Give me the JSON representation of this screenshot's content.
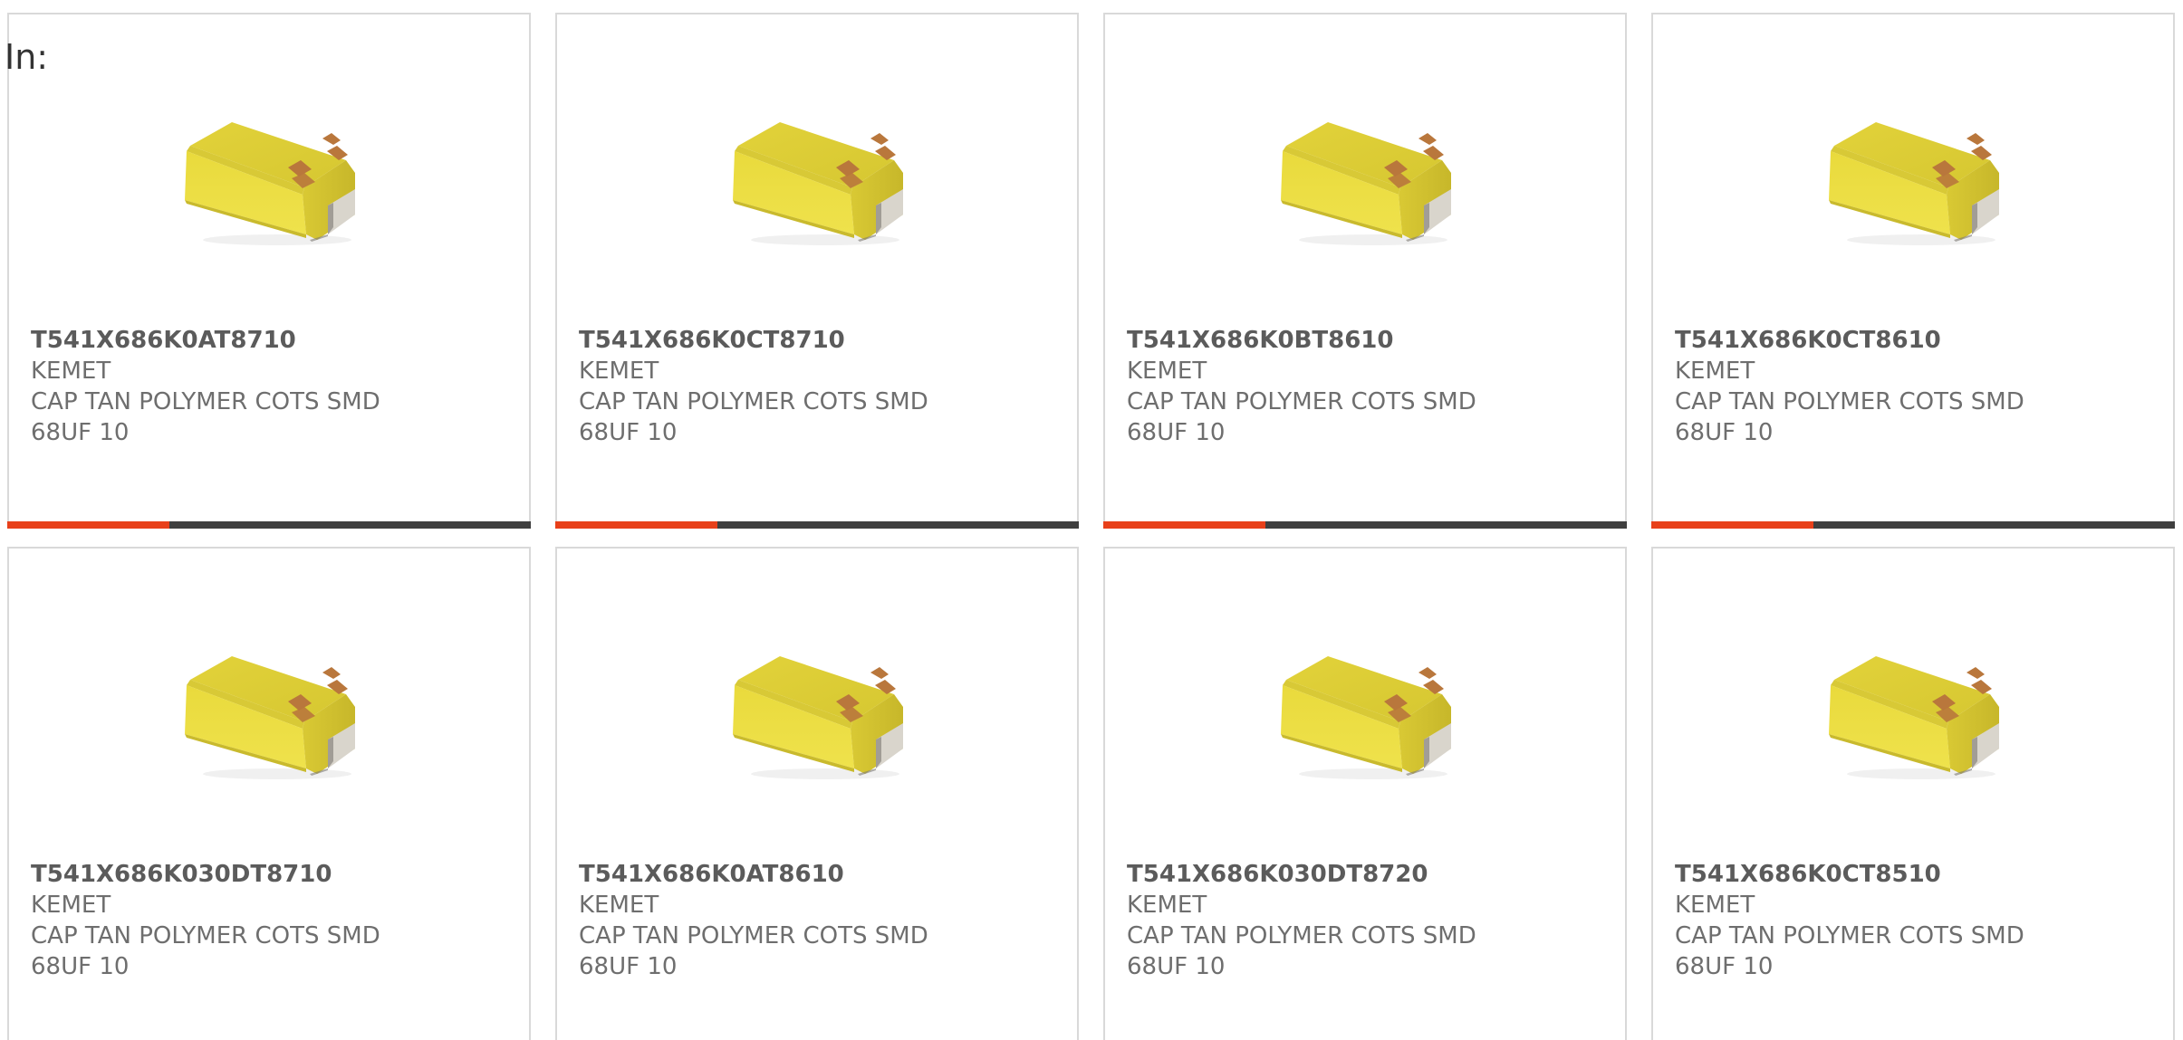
{
  "filter": {
    "label": "In:"
  },
  "colors": {
    "bar_track": "#3f3f3f",
    "bar_fill": "#e8401a",
    "part_number_text": "#5b5b5b",
    "secondary_text": "#6e6e6e",
    "card_border": "#d9d9d9",
    "capacitor_body": "#e9da3c",
    "capacitor_terminal": "#b9773c"
  },
  "products": [
    {
      "part_number": "T541X686K0AT8710",
      "manufacturer": "KEMET",
      "description_line1": "CAP TAN POLYMER COTS SMD",
      "description_line2": "68UF 10",
      "image_icon": "tantalum-capacitor-icon",
      "bar_fill_fraction": 0.31
    },
    {
      "part_number": "T541X686K0CT8710",
      "manufacturer": "KEMET",
      "description_line1": "CAP TAN POLYMER COTS SMD",
      "description_line2": "68UF 10",
      "image_icon": "tantalum-capacitor-icon",
      "bar_fill_fraction": 0.31
    },
    {
      "part_number": "T541X686K0BT8610",
      "manufacturer": "KEMET",
      "description_line1": "CAP TAN POLYMER COTS SMD",
      "description_line2": "68UF 10",
      "image_icon": "tantalum-capacitor-icon",
      "bar_fill_fraction": 0.31
    },
    {
      "part_number": "T541X686K0CT8610",
      "manufacturer": "KEMET",
      "description_line1": "CAP TAN POLYMER COTS SMD",
      "description_line2": "68UF 10",
      "image_icon": "tantalum-capacitor-icon",
      "bar_fill_fraction": 0.31
    },
    {
      "part_number": "T541X686K030DT8710",
      "manufacturer": "KEMET",
      "description_line1": "CAP TAN POLYMER COTS SMD",
      "description_line2": "68UF 10",
      "image_icon": "tantalum-capacitor-icon"
    },
    {
      "part_number": "T541X686K0AT8610",
      "manufacturer": "KEMET",
      "description_line1": "CAP TAN POLYMER COTS SMD",
      "description_line2": "68UF 10",
      "image_icon": "tantalum-capacitor-icon"
    },
    {
      "part_number": "T541X686K030DT8720",
      "manufacturer": "KEMET",
      "description_line1": "CAP TAN POLYMER COTS SMD",
      "description_line2": "68UF 10",
      "image_icon": "tantalum-capacitor-icon"
    },
    {
      "part_number": "T541X686K0CT8510",
      "manufacturer": "KEMET",
      "description_line1": "CAP TAN POLYMER COTS SMD",
      "description_line2": "68UF 10",
      "image_icon": "tantalum-capacitor-icon"
    }
  ]
}
